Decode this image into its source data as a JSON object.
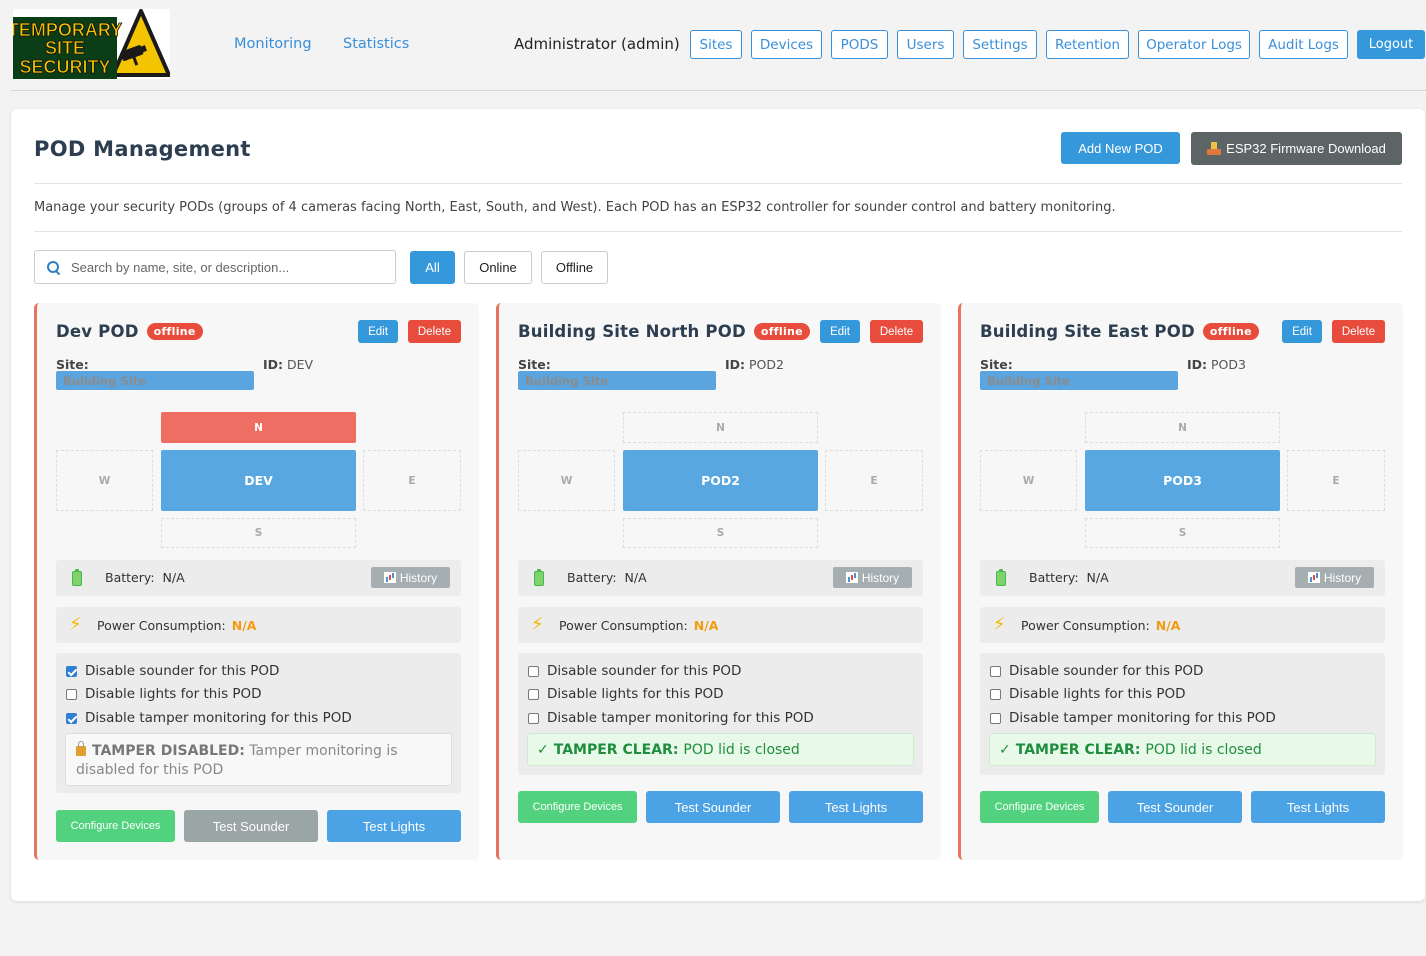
{
  "header": {
    "logo_lines": [
      "TEMPORARY",
      "SITE",
      "SECURITY"
    ],
    "nav": [
      "Monitoring",
      "Statistics"
    ],
    "user_label": "Administrator (admin)",
    "buttons": [
      "Sites",
      "Devices",
      "PODS",
      "Users",
      "Settings",
      "Retention",
      "Operator Logs",
      "Audit Logs"
    ],
    "logout": "Logout"
  },
  "page": {
    "title": "POD Management",
    "add_button": "Add New POD",
    "firmware_button": "ESP32 Firmware Download",
    "description": "Manage your security PODs (groups of 4 cameras facing North, East, South, and West). Each POD has an ESP32 controller for sounder control and battery monitoring.",
    "search_placeholder": "Search by name, site, or description...",
    "filters": [
      "All",
      "Online",
      "Offline"
    ],
    "active_filter": "All"
  },
  "labels": {
    "edit": "Edit",
    "delete": "Delete",
    "site": "Site:",
    "id": "ID:",
    "battery": "Battery:",
    "history": "History",
    "power": "Power Consumption:",
    "disable_sounder": "Disable sounder for this POD",
    "disable_lights": "Disable lights for this POD",
    "disable_tamper": "Disable tamper monitoring for this POD",
    "configure": "Configure Devices",
    "test_sounder": "Test Sounder",
    "test_lights": "Test Lights"
  },
  "pods": [
    {
      "name": "Dev POD",
      "status": "offline",
      "site": "Building Site",
      "id": "DEV",
      "cameras": {
        "n": "N",
        "e": "E",
        "s": "S",
        "w": "W"
      },
      "north_alert": true,
      "battery": "N/A",
      "power": "N/A",
      "sounder_disabled": true,
      "lights_disabled": false,
      "tamper_disabled": true,
      "tamper_title": "TAMPER DISABLED:",
      "tamper_text": "Tamper monitoring is disabled for this POD"
    },
    {
      "name": "Building Site North POD",
      "status": "offline",
      "site": "Building Site",
      "id": "POD2",
      "cameras": {
        "n": "N",
        "e": "E",
        "s": "S",
        "w": "W"
      },
      "north_alert": false,
      "battery": "N/A",
      "power": "N/A",
      "sounder_disabled": false,
      "lights_disabled": false,
      "tamper_disabled": false,
      "tamper_title": "TAMPER CLEAR:",
      "tamper_text": "POD lid is closed"
    },
    {
      "name": "Building Site East POD",
      "status": "offline",
      "site": "Building Site",
      "id": "POD3",
      "cameras": {
        "n": "N",
        "e": "E",
        "s": "S",
        "w": "W"
      },
      "north_alert": false,
      "battery": "N/A",
      "power": "N/A",
      "sounder_disabled": false,
      "lights_disabled": false,
      "tamper_disabled": false,
      "tamper_title": "TAMPER CLEAR:",
      "tamper_text": "POD lid is closed"
    }
  ],
  "colors": {
    "accent": "#3498db",
    "danger": "#e74c3c",
    "success": "#52d27e",
    "warning": "#f39c12"
  }
}
